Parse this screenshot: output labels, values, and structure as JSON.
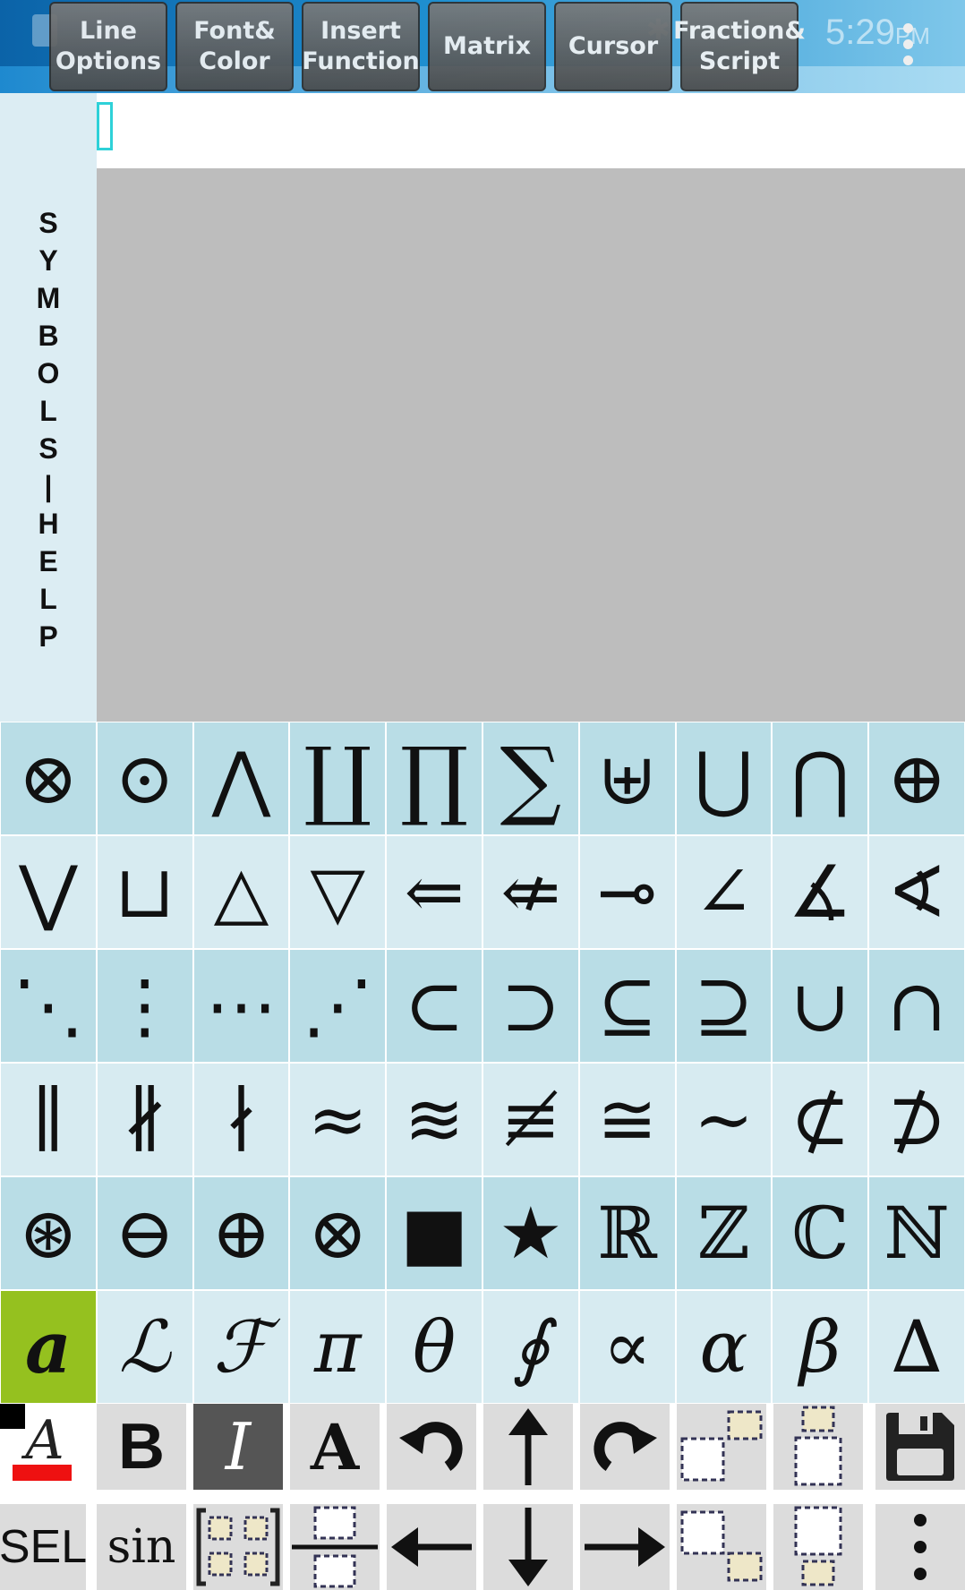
{
  "menu": {
    "line_options": "Line\nOptions",
    "font_color": "Font&\nColor",
    "insert_function": "Insert\nFunction",
    "matrix": "Matrix",
    "cursor": "Cursor",
    "fraction_script": "Fraction&\nScript"
  },
  "status": {
    "time": "5:29",
    "ampm": "PM"
  },
  "side_panel": {
    "letters": [
      "S",
      "Y",
      "M",
      "B",
      "O",
      "L",
      "S",
      "|",
      "H",
      "E",
      "L",
      "P"
    ]
  },
  "symbols": [
    [
      "⊗",
      "⊙",
      "⋀",
      "∐",
      "∏",
      "∑",
      "⊎",
      "⋃",
      "⋂",
      "⊕"
    ],
    [
      "⋁",
      "⊔",
      "△",
      "▽",
      "⇐",
      "⇍",
      "⊸",
      "∠",
      "∡",
      "∢"
    ],
    [
      "⋱",
      "⋮",
      "⋯",
      "⋰",
      "⊂",
      "⊃",
      "⊆",
      "⊇",
      "∪",
      "∩"
    ],
    [
      "∥",
      "∦",
      "∤",
      "≈",
      "≋",
      "≢",
      "≅",
      "∼",
      "⊄",
      "⊅"
    ],
    [
      "⊛",
      "⊖",
      "⊕",
      "⊗",
      "■",
      "★",
      "ℝ",
      "ℤ",
      "ℂ",
      "ℕ"
    ],
    [
      "a",
      "ℒ",
      "ℱ",
      "π",
      "θ",
      "∮",
      "∝",
      "α",
      "β",
      "∆"
    ]
  ],
  "toolbar": {
    "bold": "B",
    "italic": "I",
    "font_style": "A",
    "sel": "SEL",
    "sin": "sin",
    "text_color": "A"
  }
}
